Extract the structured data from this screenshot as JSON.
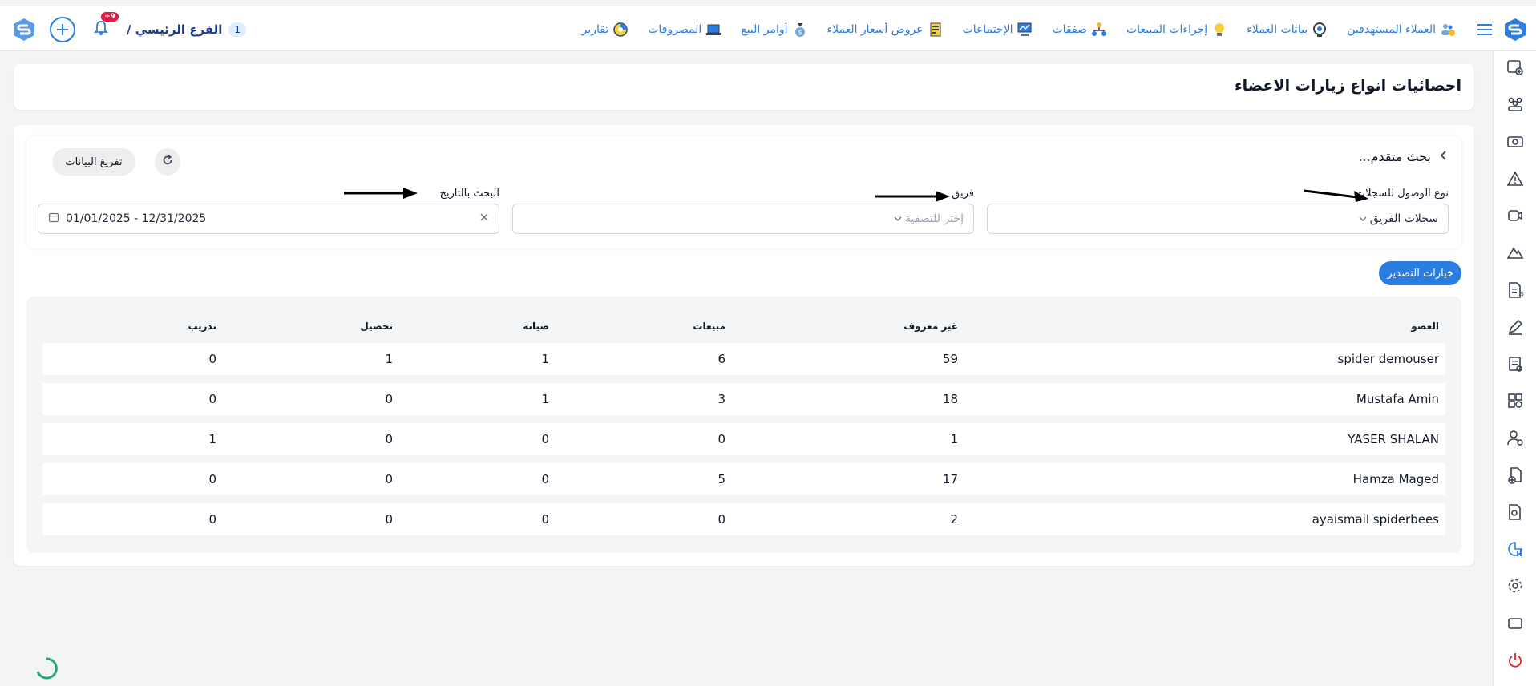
{
  "navbar": {
    "menu": [
      {
        "label": "العملاء المستهدفين",
        "icon": "users-money-icon"
      },
      {
        "label": "بيانات العملاء",
        "icon": "target-icon"
      },
      {
        "label": "إجراءات المبيعات",
        "icon": "bulb-icon"
      },
      {
        "label": "صفقات",
        "icon": "org-chart-icon"
      },
      {
        "label": "الإجتماعات",
        "icon": "presentation-icon"
      },
      {
        "label": "عروض أسعار العملاء",
        "icon": "document-icon"
      },
      {
        "label": "أوامر البيع",
        "icon": "money-bag-icon"
      },
      {
        "label": "المصروفات",
        "icon": "laptop-icon"
      },
      {
        "label": "تقارير",
        "icon": "pie-chart-icon"
      }
    ],
    "branch_label": "الفرع الرئيسي /",
    "branch_count": "1",
    "notification_count": "+9"
  },
  "page": {
    "title": "احصائيات انواع زيارات الاعضاء"
  },
  "filters": {
    "advanced_search_label": "بحث متقدم...",
    "clear_data_label": "تفريغ البيانات",
    "access_type_label": "نوع الوصول للسجلات",
    "access_type_value": "سجلات الفريق",
    "team_label": "فريق",
    "team_placeholder": "إختر للتصفية",
    "date_label": "البحث بالتاريخ",
    "date_value": "01/01/2025 - 12/31/2025"
  },
  "export_label": "خيارات التصدير",
  "table": {
    "headers": [
      "العضو",
      "غير معروف",
      "مبيعات",
      "صيانة",
      "تحصيل",
      "تدريب"
    ],
    "rows": [
      [
        "spider demouser",
        "59",
        "6",
        "1",
        "1",
        "0"
      ],
      [
        "Mustafa Amin",
        "18",
        "3",
        "1",
        "0",
        "0"
      ],
      [
        "YASER SHALAN",
        "1",
        "0",
        "0",
        "0",
        "1"
      ],
      [
        "Hamza Maged",
        "17",
        "5",
        "0",
        "0",
        "0"
      ],
      [
        "ayaismail spiderbees",
        "2",
        "0",
        "0",
        "0",
        "0"
      ]
    ]
  },
  "colors": {
    "accent": "#2b7de0",
    "badge": "#e11d48",
    "background": "#f3f4f6"
  }
}
